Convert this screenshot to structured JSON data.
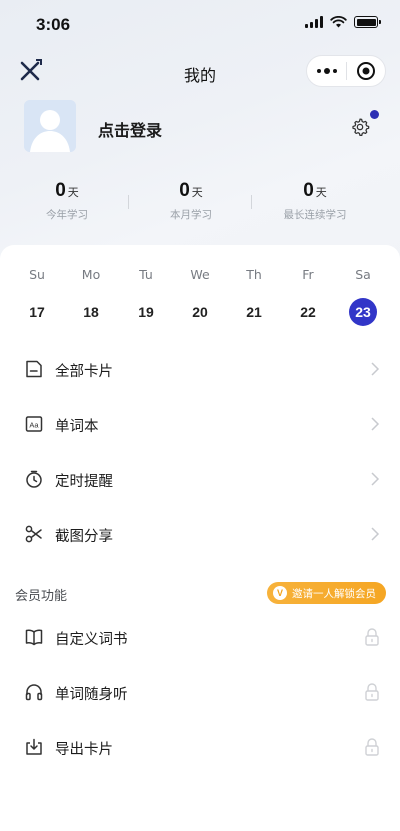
{
  "status_bar": {
    "time": "3:06"
  },
  "nav": {
    "title": "我的"
  },
  "profile": {
    "login_label": "点击登录"
  },
  "stats": [
    {
      "value": "0",
      "unit": "天",
      "label": "今年学习"
    },
    {
      "value": "0",
      "unit": "天",
      "label": "本月学习"
    },
    {
      "value": "0",
      "unit": "天",
      "label": "最长连续学习"
    }
  ],
  "week": {
    "days": [
      "Su",
      "Mo",
      "Tu",
      "We",
      "Th",
      "Fr",
      "Sa"
    ],
    "dates": [
      "17",
      "18",
      "19",
      "20",
      "21",
      "22",
      "23"
    ],
    "active_date": "23",
    "accent_color": "#3236c8"
  },
  "menu": [
    {
      "label": "全部卡片",
      "icon": "card-icon"
    },
    {
      "label": "单词本",
      "icon": "wordbook-icon"
    },
    {
      "label": "定时提醒",
      "icon": "alarm-icon"
    },
    {
      "label": "截图分享",
      "icon": "scissors-icon"
    }
  ],
  "member": {
    "section_title": "会员功能",
    "invite_badge": "邀请一人解锁会员",
    "badge_letter": "V",
    "badge_color": "#f5a623",
    "items": [
      {
        "label": "自定义词书",
        "icon": "book-icon"
      },
      {
        "label": "单词随身听",
        "icon": "headphones-icon"
      },
      {
        "label": "导出卡片",
        "icon": "export-icon"
      }
    ]
  }
}
